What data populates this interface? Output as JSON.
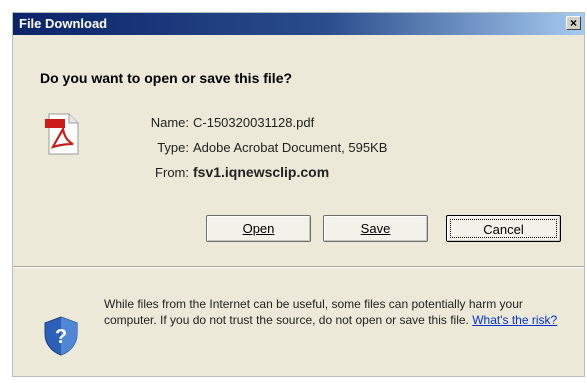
{
  "window": {
    "title": "File Download",
    "close_glyph": "×"
  },
  "question": "Do you want to open or save this file?",
  "file": {
    "icon": "pdf-icon",
    "name_label": "Name:",
    "name_value": "C-150320031128.pdf",
    "type_label": "Type:",
    "type_value": "Adobe Acrobat Document, 595KB",
    "from_label": "From:",
    "from_value": "fsv1.iqnewsclip.com"
  },
  "buttons": {
    "open": "Open",
    "save": "Save",
    "cancel": "Cancel"
  },
  "warning": {
    "icon": "shield-question-icon",
    "text": "While files from the Internet can be useful, some files can potentially harm your computer. If you do not trust the source, do not open or save this file.",
    "link": "What's the risk?"
  },
  "colors": {
    "accent": "#0a246a",
    "link": "#0033cc",
    "pdf_red": "#cc1b1b",
    "shield_blue": "#2b5fb8"
  }
}
